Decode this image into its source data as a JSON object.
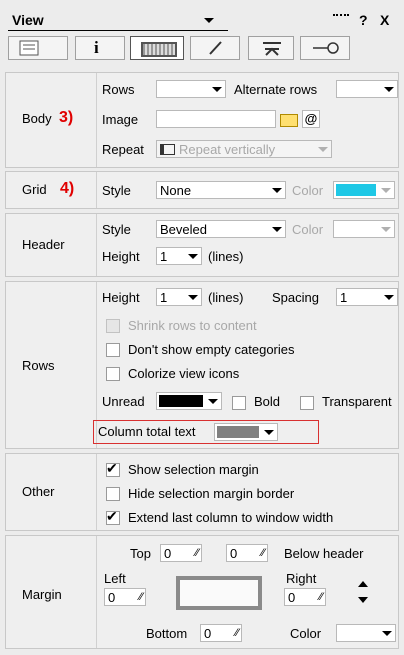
{
  "header": {
    "title": "View",
    "icons": [
      "keyboard-icon",
      "help-icon",
      "close-icon"
    ],
    "help": "?",
    "close": "X"
  },
  "tabs": [
    "list-view-icon",
    "info-icon",
    "layout-icon",
    "pen-icon",
    "filter-icon",
    "key-icon"
  ],
  "body": {
    "label": "Body",
    "badge": "3)",
    "rows_label": "Rows",
    "alt_rows_label": "Alternate rows",
    "image_label": "Image",
    "at": "@",
    "repeat_label": "Repeat",
    "repeat_value": "Repeat vertically"
  },
  "grid": {
    "label": "Grid",
    "badge": "4)",
    "style_label": "Style",
    "style_value": "None",
    "color_label": "Color",
    "color": "#1ec8e6"
  },
  "header_sec": {
    "label": "Header",
    "style_label": "Style",
    "style_value": "Beveled",
    "color_label": "Color",
    "height_label": "Height",
    "height_value": "1",
    "lines": "(lines)"
  },
  "rows": {
    "label": "Rows",
    "height_label": "Height",
    "height_value": "1",
    "lines": "(lines)",
    "spacing_label": "Spacing",
    "spacing_value": "1",
    "shrink": "Shrink rows to content",
    "empty": "Don't show empty categories",
    "colorize": "Colorize view icons",
    "unread_label": "Unread",
    "bold": "Bold",
    "transparent": "Transparent",
    "total_label": "Column total text",
    "unread_color": "#000000",
    "total_color": "#808080"
  },
  "other": {
    "label": "Other",
    "sel_margin": "Show selection margin",
    "hide_border": "Hide selection margin border",
    "extend": "Extend last column to window width"
  },
  "margin": {
    "label": "Margin",
    "top_label": "Top",
    "top_value": "0",
    "below_value": "0",
    "below_label": "Below header",
    "left_label": "Left",
    "left_value": "0",
    "right_label": "Right",
    "right_value": "0",
    "bottom_label": "Bottom",
    "bottom_value": "0",
    "color_label": "Color"
  }
}
